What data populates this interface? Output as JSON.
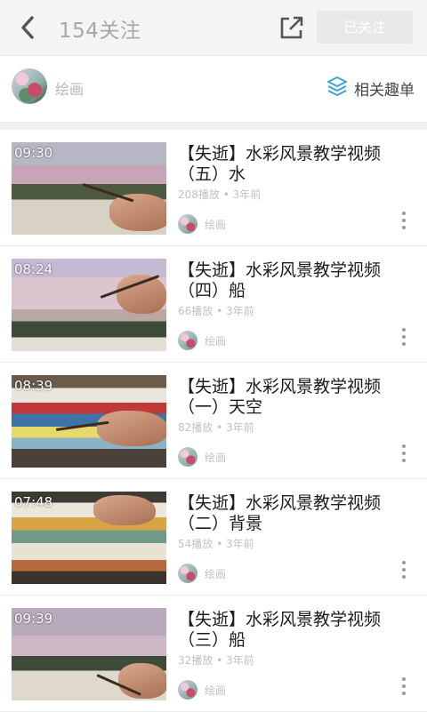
{
  "header": {
    "title": "154关注",
    "follow_label": "已关注",
    "back_icon": "chevron-left-icon",
    "share_icon": "share-external-icon"
  },
  "channel": {
    "name": "绘画",
    "related_label": "相关趣单",
    "related_icon": "layers-icon",
    "accent_color": "#3aa6d8"
  },
  "videos": [
    {
      "duration": "09:30",
      "title": "【失逝】水彩风景教学视频（五）水",
      "meta": "208播放 • 3年前",
      "author": "绘画"
    },
    {
      "duration": "08:24",
      "title": "【失逝】水彩风景教学视频（四）船",
      "meta": "66播放 • 3年前",
      "author": "绘画"
    },
    {
      "duration": "08:39",
      "title": "【失逝】水彩风景教学视频（一）天空",
      "meta": "82播放 • 3年前",
      "author": "绘画"
    },
    {
      "duration": "07:48",
      "title": "【失逝】水彩风景教学视频（二）背景",
      "meta": "54播放 • 3年前",
      "author": "绘画"
    },
    {
      "duration": "09:39",
      "title": "【失逝】水彩风景教学视频（三）船",
      "meta": "32播放 • 3年前",
      "author": "绘画"
    }
  ]
}
